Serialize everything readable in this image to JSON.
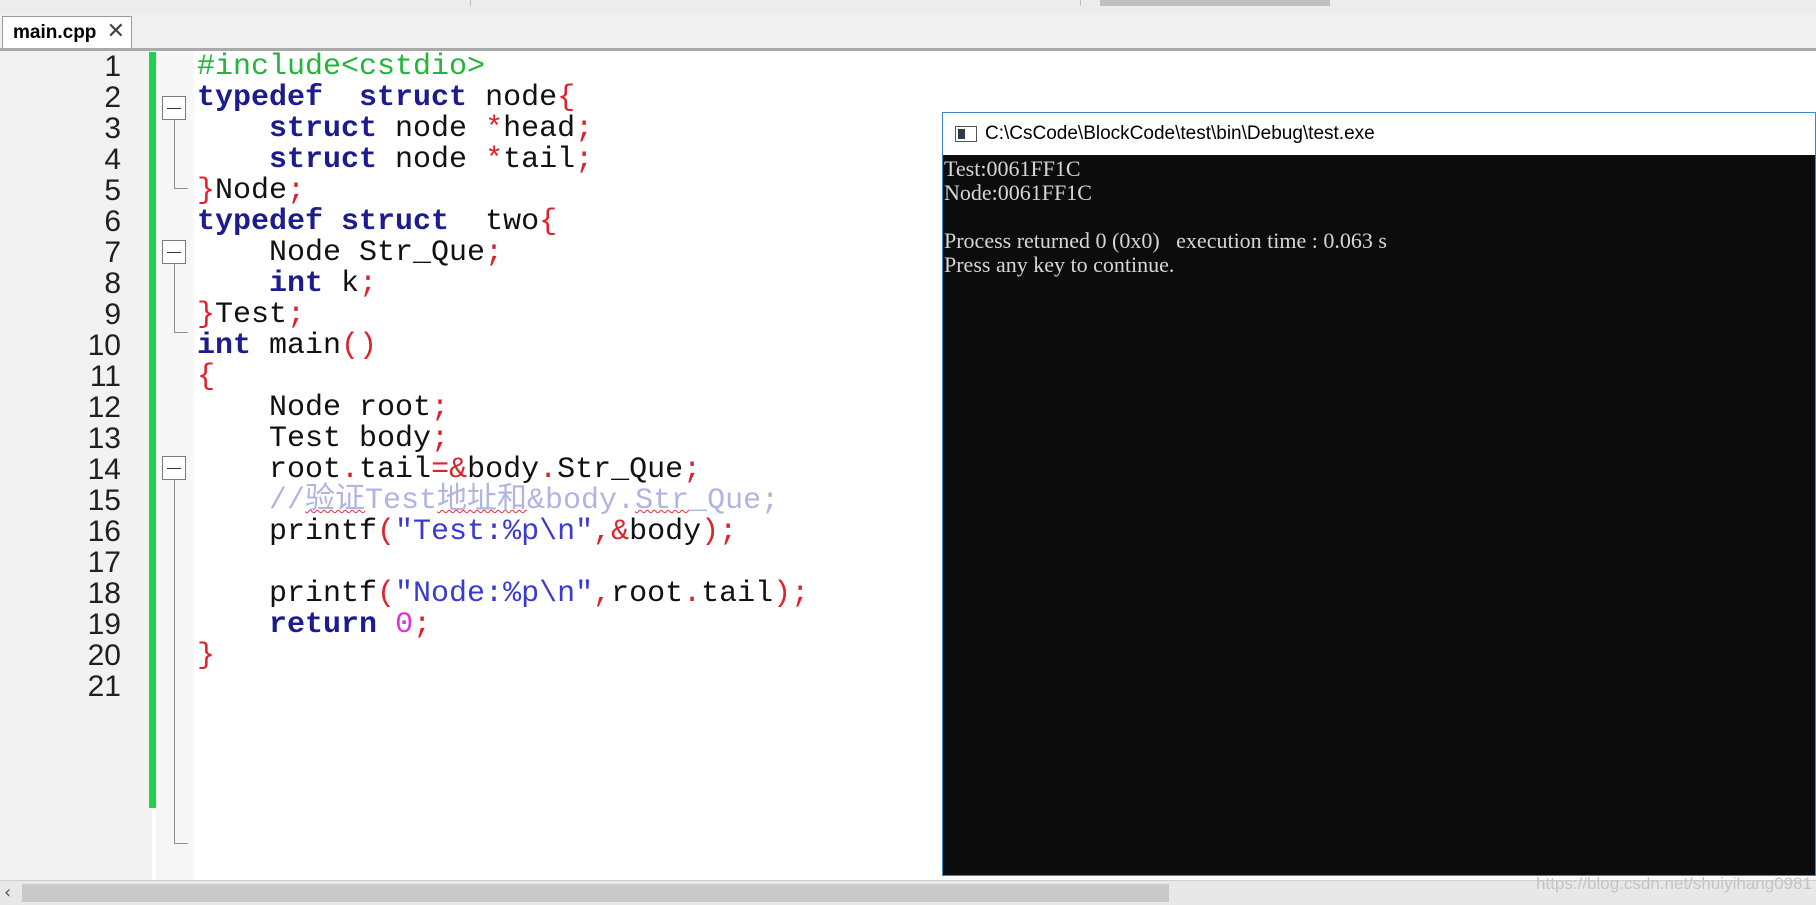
{
  "tab": {
    "label": "main.cpp",
    "close_symbol": "✕"
  },
  "editor": {
    "lines": [
      {
        "n": "1",
        "tokens": [
          [
            "pp",
            "#include<cstdio>"
          ]
        ]
      },
      {
        "n": "2",
        "tokens": [
          [
            "kw",
            "typedef"
          ],
          [
            "id",
            "  "
          ],
          [
            "kw",
            "struct"
          ],
          [
            "id",
            " node"
          ],
          [
            "op",
            "{"
          ]
        ]
      },
      {
        "n": "3",
        "tokens": [
          [
            "id",
            "    "
          ],
          [
            "kw",
            "struct"
          ],
          [
            "id",
            " node "
          ],
          [
            "op",
            "*"
          ],
          [
            "id",
            "head"
          ],
          [
            "op",
            ";"
          ]
        ]
      },
      {
        "n": "4",
        "tokens": [
          [
            "id",
            "    "
          ],
          [
            "kw",
            "struct"
          ],
          [
            "id",
            " node "
          ],
          [
            "op",
            "*"
          ],
          [
            "id",
            "tail"
          ],
          [
            "op",
            ";"
          ]
        ]
      },
      {
        "n": "5",
        "tokens": [
          [
            "op",
            "}"
          ],
          [
            "id",
            "Node"
          ],
          [
            "op",
            ";"
          ]
        ]
      },
      {
        "n": "6",
        "tokens": [
          [
            "kw",
            "typedef"
          ],
          [
            "id",
            " "
          ],
          [
            "kw",
            "struct"
          ],
          [
            "id",
            "  two"
          ],
          [
            "op",
            "{"
          ]
        ]
      },
      {
        "n": "7",
        "tokens": [
          [
            "id",
            "    Node Str_Que"
          ],
          [
            "op",
            ";"
          ]
        ]
      },
      {
        "n": "8",
        "tokens": [
          [
            "id",
            "    "
          ],
          [
            "kw",
            "int"
          ],
          [
            "id",
            " k"
          ],
          [
            "op",
            ";"
          ]
        ]
      },
      {
        "n": "9",
        "tokens": [
          [
            "op",
            "}"
          ],
          [
            "id",
            "Test"
          ],
          [
            "op",
            ";"
          ]
        ]
      },
      {
        "n": "10",
        "tokens": [
          [
            "kw",
            "int"
          ],
          [
            "id",
            " main"
          ],
          [
            "op",
            "()"
          ]
        ]
      },
      {
        "n": "11",
        "tokens": [
          [
            "op",
            "{"
          ]
        ]
      },
      {
        "n": "12",
        "tokens": [
          [
            "id",
            "    Node root"
          ],
          [
            "op",
            ";"
          ]
        ]
      },
      {
        "n": "13",
        "tokens": [
          [
            "id",
            "    Test body"
          ],
          [
            "op",
            ";"
          ]
        ]
      },
      {
        "n": "14",
        "tokens": [
          [
            "id",
            "    root"
          ],
          [
            "op",
            "."
          ],
          [
            "id",
            "tail"
          ],
          [
            "op",
            "=&"
          ],
          [
            "id",
            "body"
          ],
          [
            "op",
            "."
          ],
          [
            "id",
            "Str_Que"
          ],
          [
            "op",
            ";"
          ]
        ]
      },
      {
        "n": "15",
        "tokens": [
          [
            "cm",
            "    //"
          ],
          [
            "cm sq",
            "验证"
          ],
          [
            "cm",
            "Test"
          ],
          [
            "cm sq",
            "地址和"
          ],
          [
            "cm",
            "&body."
          ],
          [
            "cm sq",
            "Str"
          ],
          [
            "cm",
            "_Que;"
          ]
        ]
      },
      {
        "n": "16",
        "tokens": [
          [
            "id",
            "    printf"
          ],
          [
            "op",
            "("
          ],
          [
            "str",
            "\"Test:%p\\n\""
          ],
          [
            "op",
            ",&"
          ],
          [
            "id",
            "body"
          ],
          [
            "op",
            ");"
          ]
        ]
      },
      {
        "n": "17",
        "tokens": []
      },
      {
        "n": "18",
        "tokens": [
          [
            "id",
            "    printf"
          ],
          [
            "op",
            "("
          ],
          [
            "str",
            "\"Node:%p\\n\""
          ],
          [
            "op",
            ","
          ],
          [
            "id",
            "root"
          ],
          [
            "op",
            "."
          ],
          [
            "id",
            "tail"
          ],
          [
            "op",
            ");"
          ]
        ]
      },
      {
        "n": "19",
        "tokens": [
          [
            "id",
            "    "
          ],
          [
            "kw",
            "return"
          ],
          [
            "id",
            " "
          ],
          [
            "num",
            "0"
          ],
          [
            "op",
            ";"
          ]
        ]
      },
      {
        "n": "20",
        "tokens": [
          [
            "op",
            "}"
          ]
        ]
      },
      {
        "n": "21",
        "tokens": []
      }
    ]
  },
  "console": {
    "title": "C:\\CsCode\\BlockCode\\test\\bin\\Debug\\test.exe",
    "output": [
      "Test:0061FF1C",
      "Node:0061FF1C",
      "",
      "Process returned 0 (0x0)   execution time : 0.063 s",
      "Press any key to continue."
    ]
  },
  "watermark": "https://blog.csdn.net/shuiyihang0981"
}
